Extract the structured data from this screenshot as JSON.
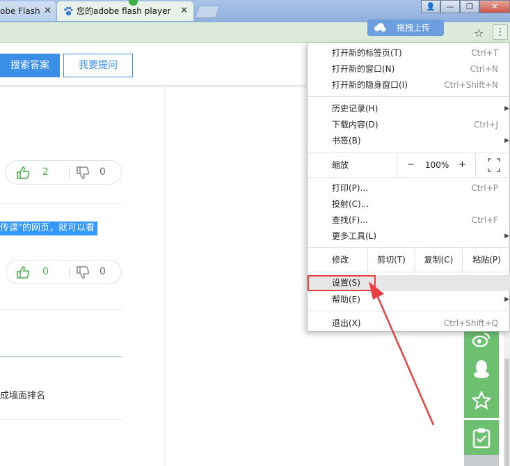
{
  "tabs": {
    "inactive_title": "obe Flash",
    "active_title": "您的adobe flash player",
    "close_glyph": "✕"
  },
  "window_buttons": {
    "user": "👤",
    "minimize": "—",
    "maximize": "❐",
    "close": "✕"
  },
  "toolbar": {
    "upload_label": "拖拽上传",
    "star_glyph": "☆",
    "menu_glyph": "⋮"
  },
  "page": {
    "search_button": "搜索答案",
    "ask_button": "我要提问",
    "answers": [
      {
        "up": "2",
        "down": "0"
      },
      {
        "up": "0",
        "down": "0"
      }
    ],
    "selected_text": "传课\"的网页，就可以看",
    "snippet_text": "成墙面排名"
  },
  "menu": {
    "items_group1": [
      {
        "label": "打开新的标签页(T)",
        "shortcut": "Ctrl+T"
      },
      {
        "label": "打开新的窗口(N)",
        "shortcut": "Ctrl+N"
      },
      {
        "label": "打开新的隐身窗口(I)",
        "shortcut": "Ctrl+Shift+N"
      }
    ],
    "items_group2": [
      {
        "label": "历史记录(H)",
        "shortcut": "",
        "submenu": "▶"
      },
      {
        "label": "下载内容(D)",
        "shortcut": "Ctrl+J",
        "submenu": ""
      },
      {
        "label": "书签(B)",
        "shortcut": "",
        "submenu": "▶"
      }
    ],
    "zoom": {
      "label": "缩放",
      "minus": "−",
      "value": "100%",
      "plus": "+"
    },
    "items_group3": [
      {
        "label": "打印(P)...",
        "shortcut": "Ctrl+P",
        "submenu": ""
      },
      {
        "label": "投射(C)...",
        "shortcut": "",
        "submenu": ""
      },
      {
        "label": "查找(F)...",
        "shortcut": "Ctrl+F",
        "submenu": ""
      },
      {
        "label": "更多工具(L)",
        "shortcut": "",
        "submenu": "▶"
      }
    ],
    "edit": {
      "label": "修改",
      "cut": "剪切(T)",
      "copy": "复制(C)",
      "paste": "粘贴(P)"
    },
    "settings": {
      "label": "设置(S)"
    },
    "help": {
      "label": "帮助(E)",
      "submenu": "▶"
    },
    "exit": {
      "label": "退出(X)",
      "shortcut": "Ctrl+Shift+Q"
    }
  },
  "colors": {
    "accent_blue": "#3a8ee6",
    "sidebar_green": "#6dc070",
    "highlight_red": "#e84040"
  }
}
